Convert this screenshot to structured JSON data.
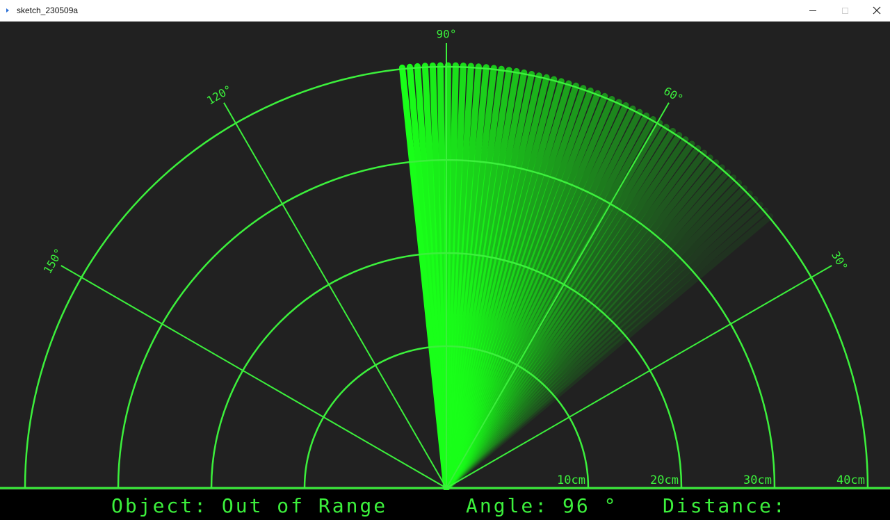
{
  "window": {
    "title": "sketch_230509a",
    "controls": {
      "minimize": "minimize-icon",
      "maximize": "maximize-icon",
      "close": "close-icon"
    }
  },
  "colors": {
    "background": "#212121",
    "radar_green": "#3cf03c",
    "sweep_bright": "#19ff19",
    "hud_background": "#000000"
  },
  "radar": {
    "angle_labels": [
      "30°",
      "60°",
      "90°",
      "120°",
      "150°"
    ],
    "distance_labels": [
      "10cm",
      "20cm",
      "30cm",
      "40cm"
    ],
    "sweep_angle_deg": 96,
    "sweep_trail_end_deg": 40
  },
  "hud": {
    "object_text": "Object: Out of Range",
    "angle_text": "Angle: 96 °",
    "distance_text": "Distance:"
  }
}
